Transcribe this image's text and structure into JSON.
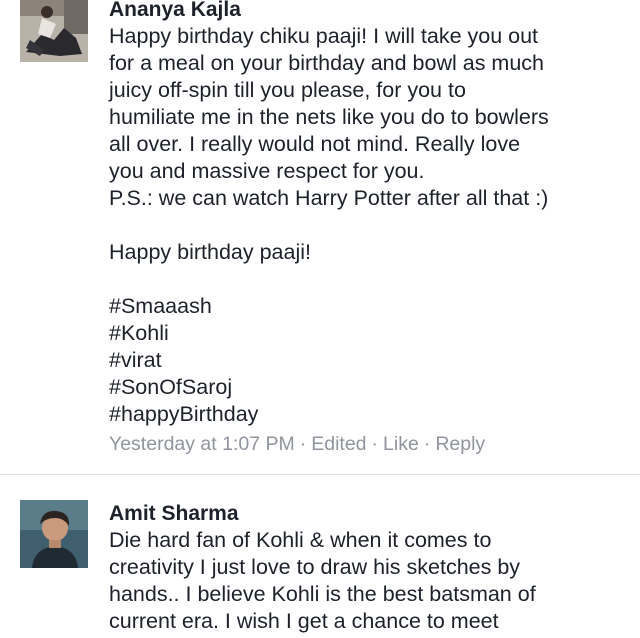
{
  "comments": [
    {
      "author": "Ananya Kajla",
      "lines": [
        "Happy birthday chiku paaji! I will take you out",
        "for a meal on your birthday and bowl as much",
        "juicy off-spin till you please, for you to",
        "humiliate me in the nets like you do to bowlers",
        "all over. I really would not mind. Really love",
        "you and massive respect for you.",
        "P.S.: we can watch Harry Potter after all that :)"
      ],
      "closing": "Happy birthday paaji!",
      "hashtags": [
        "#Smaaash",
        "#Kohli",
        "#virat",
        "#SonOfSaroj",
        "#happyBirthday"
      ],
      "meta": {
        "time": "Yesterday at 1:07 PM",
        "edited": "Edited",
        "like": "Like",
        "reply": "Reply",
        "separator": "·"
      },
      "avatar_icon": "user-photo-icon"
    },
    {
      "author": "Amit Sharma",
      "lines": [
        "Die hard fan of Kohli & when it comes to",
        "creativity I just love to draw his sketches by",
        "hands.. I believe Kohli is the best batsman of",
        "current era. I wish I get a chance to meet"
      ],
      "avatar_icon": "user-photo-icon"
    }
  ],
  "colors": {
    "text": "#1d2129",
    "meta": "#90949c",
    "divider": "#dddfe2"
  }
}
